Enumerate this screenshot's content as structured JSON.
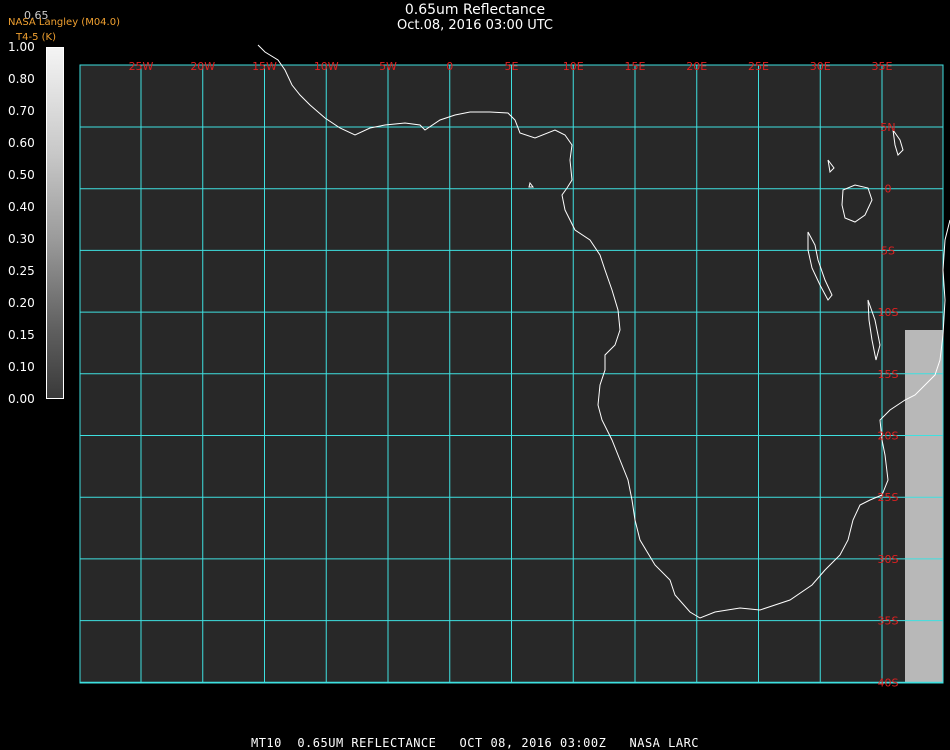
{
  "header": {
    "title": "0.65um Reflectance",
    "subtitle": "Oct.08, 2016 03:00 UTC",
    "overlay_top": "0.65",
    "overlay_line1": "NASA Langley (M04.0)",
    "overlay_line2": "T4-5 (K)"
  },
  "colorbar": {
    "labels": [
      "1.00",
      "0.80",
      "0.70",
      "0.60",
      "0.50",
      "0.40",
      "0.30",
      "0.25",
      "0.20",
      "0.15",
      "0.10",
      "0.00"
    ]
  },
  "map": {
    "background": "#282828",
    "grid_color": "#3ee0e0",
    "label_color": "#e02020",
    "coast_color": "#ffffff",
    "lon_labels": [
      "25W",
      "20W",
      "15W",
      "10W",
      "5W",
      "0",
      "5E",
      "10E",
      "15E",
      "20E",
      "25E",
      "30E",
      "35E"
    ],
    "lat_labels": [
      "5N",
      "0",
      "5S",
      "10S",
      "15S",
      "20S",
      "25S",
      "30S",
      "35S",
      "40S"
    ]
  },
  "footer": {
    "text": "MT10  0.65UM REFLECTANCE   OCT 08, 2016 03:00Z   NASA LARC"
  }
}
